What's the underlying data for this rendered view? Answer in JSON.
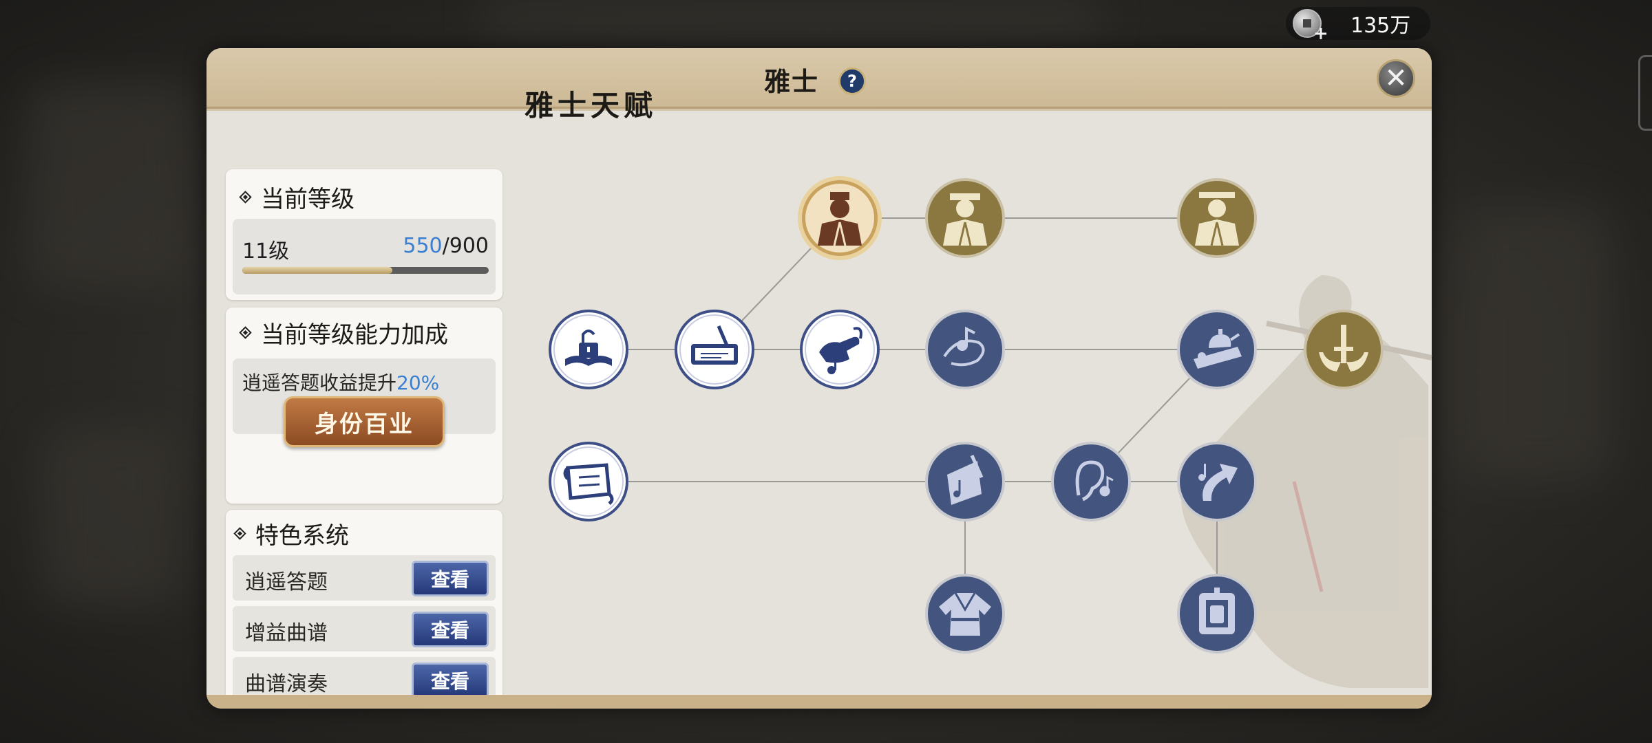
{
  "currency": {
    "amount": "135万",
    "icon": "silver-coin-icon"
  },
  "panel": {
    "title": "雅士",
    "help_label": "?",
    "close_label": "✕"
  },
  "level_card": {
    "title": "当前等级",
    "level_text": "11级",
    "xp_current": "550",
    "xp_separator": "/",
    "xp_max": "900",
    "xp_progress": 0.61
  },
  "bonus_card": {
    "title": "当前等级能力加成",
    "bonus_text": "逍遥答题收益提升",
    "bonus_percent": "20%"
  },
  "career_button": {
    "label": "身份百业"
  },
  "features_card": {
    "title": "特色系统",
    "items": [
      {
        "label": "逍遥答题",
        "button": "查看"
      },
      {
        "label": "增益曲谱",
        "button": "查看"
      },
      {
        "label": "曲谱演奏",
        "button": "查看"
      }
    ]
  },
  "tree": {
    "title": "雅士天赋",
    "nodes": [
      {
        "id": "scholar-portrait",
        "icon": "scholar-portrait-icon",
        "state": "selected"
      },
      {
        "id": "scholar-tier-2",
        "icon": "scholar-portrait-icon",
        "state": "gold"
      },
      {
        "id": "scholar-tier-3",
        "icon": "scholar-portrait-icon",
        "state": "gold"
      },
      {
        "id": "unlock-book",
        "icon": "unlock-book-icon",
        "state": "unlocked"
      },
      {
        "id": "scroll-writing",
        "icon": "scroll-writing-icon",
        "state": "unlocked"
      },
      {
        "id": "music-hand",
        "icon": "music-hand-icon",
        "state": "unlocked"
      },
      {
        "id": "music-note",
        "icon": "music-note-icon",
        "state": "locked"
      },
      {
        "id": "tea-set",
        "icon": "tea-set-icon",
        "state": "locked"
      },
      {
        "id": "sword-crest",
        "icon": "sword-crest-icon",
        "state": "gold"
      },
      {
        "id": "open-scroll",
        "icon": "open-scroll-icon",
        "state": "unlocked"
      },
      {
        "id": "music-sheet",
        "icon": "music-sheet-icon",
        "state": "locked"
      },
      {
        "id": "ear-note",
        "icon": "ear-note-icon",
        "state": "locked"
      },
      {
        "id": "upgrade-arrow",
        "icon": "upgrade-arrow-icon",
        "state": "locked"
      },
      {
        "id": "robe",
        "icon": "robe-icon",
        "state": "locked"
      },
      {
        "id": "frame-device",
        "icon": "frame-device-icon",
        "state": "locked"
      }
    ]
  },
  "colors": {
    "unlocked_node": "#ffffff",
    "locked_node": "#43557f",
    "gold_node": "#8a7840",
    "accent_blue": "#3a7fd0"
  }
}
